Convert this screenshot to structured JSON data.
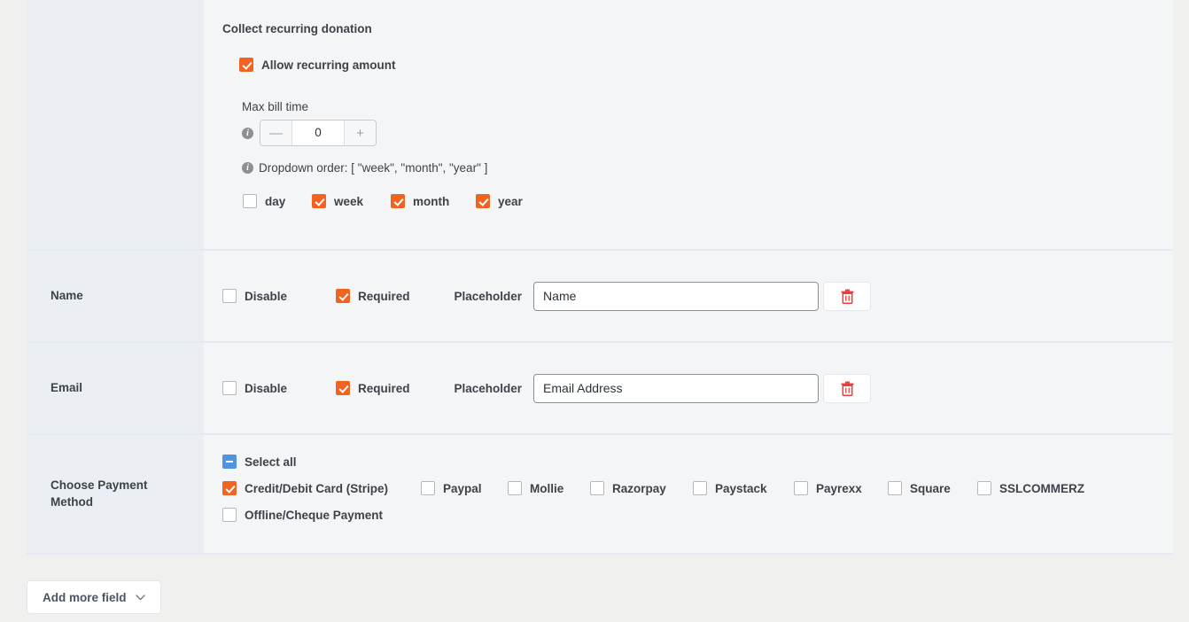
{
  "recurring": {
    "section_title": "Collect recurring donation",
    "allow_label": "Allow recurring amount",
    "allow_checked": true,
    "max_bill_time_label": "Max bill time",
    "max_bill_time_value": "0",
    "stepper_minus": "—",
    "stepper_plus": "+",
    "info_glyph": "i",
    "dropdown_order_text": "Dropdown order: [ \"week\", \"month\", \"year\" ]",
    "frequencies": [
      {
        "label": "day",
        "checked": false
      },
      {
        "label": "week",
        "checked": true
      },
      {
        "label": "month",
        "checked": true
      },
      {
        "label": "year",
        "checked": true
      }
    ]
  },
  "fields": [
    {
      "label": "Name",
      "disable_label": "Disable",
      "disable_checked": false,
      "required_label": "Required",
      "required_checked": true,
      "placeholder_label": "Placeholder",
      "placeholder_value": "Name",
      "delete_icon": "trash-icon"
    },
    {
      "label": "Email",
      "disable_label": "Disable",
      "disable_checked": false,
      "required_label": "Required",
      "required_checked": true,
      "placeholder_label": "Placeholder",
      "placeholder_value": "Email Address",
      "delete_icon": "trash-icon"
    }
  ],
  "payment": {
    "label": "Choose Payment Method",
    "select_all_label": "Select all",
    "select_all_state": "indeterminate",
    "methods_row1": [
      {
        "label": "Credit/Debit Card (Stripe)",
        "checked": true
      },
      {
        "label": "Paypal",
        "checked": false
      },
      {
        "label": "Mollie",
        "checked": false
      },
      {
        "label": "Razorpay",
        "checked": false
      },
      {
        "label": "Paystack",
        "checked": false
      },
      {
        "label": "Payrexx",
        "checked": false
      },
      {
        "label": "Square",
        "checked": false
      },
      {
        "label": "SSLCOMMERZ",
        "checked": false
      }
    ],
    "methods_row2": [
      {
        "label": "Offline/Cheque Payment",
        "checked": false
      }
    ]
  },
  "footer": {
    "add_more_label": "Add more field",
    "chevron_icon": "chevron-down-icon"
  },
  "colors": {
    "accent": "#f26322",
    "select_all": "#4f94e0",
    "delete": "#f03b3b",
    "label_bg": "#ebeef3",
    "row_bg": "#f4f5f7"
  }
}
